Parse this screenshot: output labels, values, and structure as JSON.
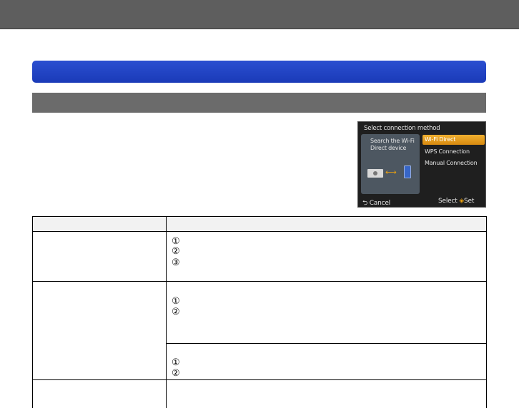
{
  "camera_screen": {
    "title": "Select connection method",
    "description": "Search the Wi-Fi Direct device",
    "options": [
      "Wi-Fi Direct",
      "WPS Connection",
      "Manual Connection"
    ],
    "footer_cancel": "Cancel",
    "footer_select": "Select",
    "footer_set": "Set"
  },
  "table": {
    "steps": [
      "①",
      "②",
      "③"
    ]
  }
}
